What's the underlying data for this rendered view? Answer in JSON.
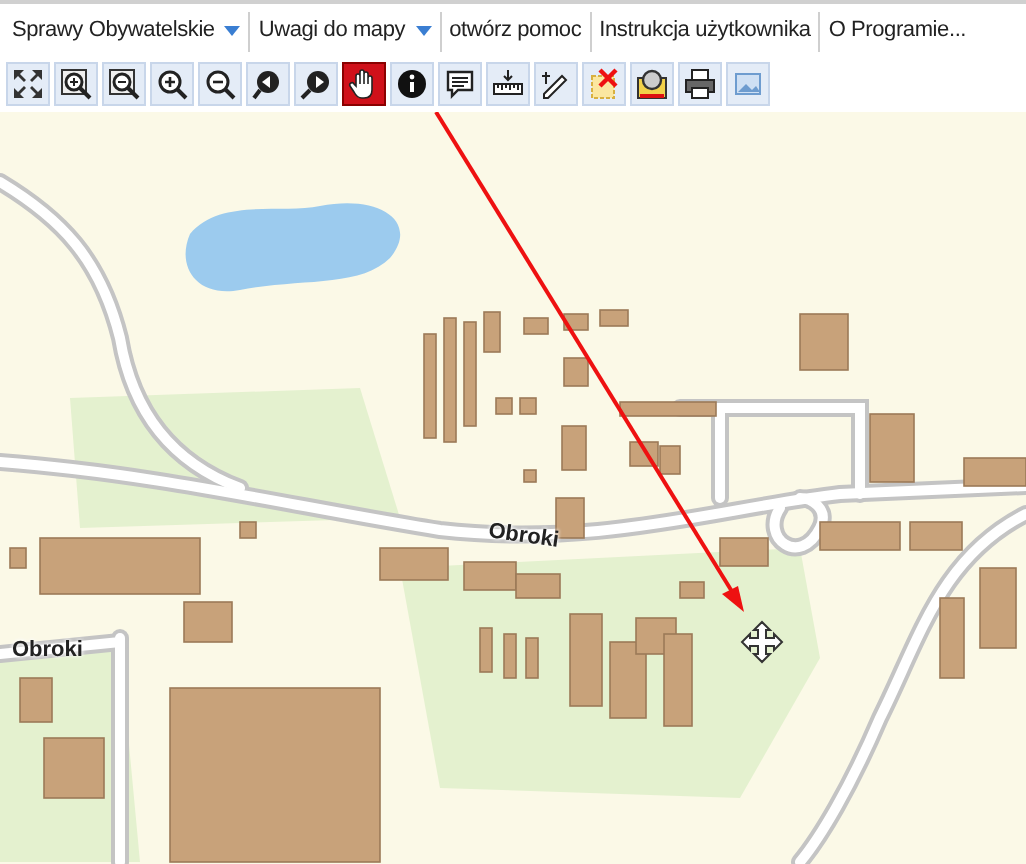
{
  "menu": [
    {
      "label": "Sprawy Obywatelskie",
      "has_dropdown": true
    },
    {
      "label": "Uwagi do mapy",
      "has_dropdown": true
    },
    {
      "label": "otwórz pomoc",
      "has_dropdown": false
    },
    {
      "label": "Instrukcja użytkownika",
      "has_dropdown": false
    },
    {
      "label": "O Programie...",
      "has_dropdown": false
    }
  ],
  "toolbar": [
    {
      "selected": false
    },
    {
      "selected": false
    },
    {
      "selected": false
    },
    {
      "selected": false
    },
    {
      "selected": false
    },
    {
      "selected": false
    },
    {
      "selected": false
    },
    {
      "selected": true
    },
    {
      "selected": false
    },
    {
      "selected": false
    },
    {
      "selected": false
    },
    {
      "selected": false
    },
    {
      "selected": false
    },
    {
      "selected": false
    },
    {
      "selected": false
    },
    {
      "selected": false
    }
  ],
  "map": {
    "street_labels": [
      {
        "text": "Obroki"
      },
      {
        "text": "Obroki"
      }
    ]
  }
}
